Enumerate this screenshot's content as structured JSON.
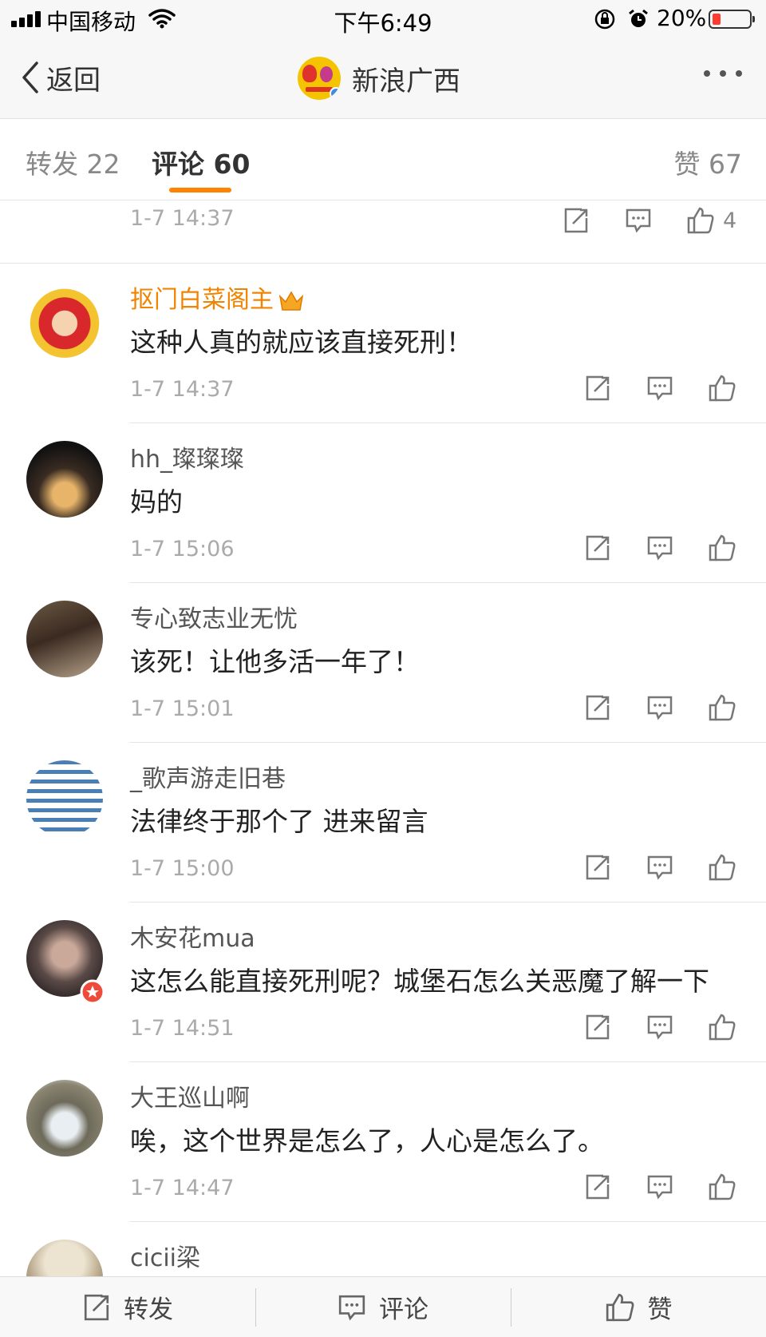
{
  "status_bar": {
    "carrier": "中国移动",
    "time": "下午6:49",
    "battery": "20%"
  },
  "nav": {
    "back_label": "返回",
    "title": "新浪广西"
  },
  "tabs": {
    "repost": "转发 22",
    "comment": "评论 60",
    "like": "赞 67"
  },
  "partial_row": {
    "time": "1-7 14:37",
    "likes": "4"
  },
  "comments": [
    {
      "user": "抠门白菜阁主",
      "text": "这种人真的就应该直接死刑！",
      "time": "1-7 14:37"
    },
    {
      "user": "hh_璨璨璨",
      "text": "妈的",
      "time": "1-7 15:06"
    },
    {
      "user": "专心致志业无忧",
      "text": "该死！让他多活一年了！",
      "time": "1-7 15:01"
    },
    {
      "user": "_歌声游走旧巷",
      "text": "法律终于那个了 进来留言",
      "time": "1-7 15:00"
    },
    {
      "user": "木安花mua",
      "text": "这怎么能直接死刑呢？城堡石怎么关恶魔了解一下",
      "time": "1-7 14:51"
    },
    {
      "user": "大王巡山啊",
      "text": "唉，这个世界是怎么了，人心是怎么了。",
      "time": "1-7 14:47"
    },
    {
      "user": "cicii梁"
    }
  ],
  "toolbar": {
    "repost": "转发",
    "comment": "评论",
    "like": "赞"
  },
  "colors": {
    "accent": "#ff8200",
    "vip_name": "#f08300"
  }
}
